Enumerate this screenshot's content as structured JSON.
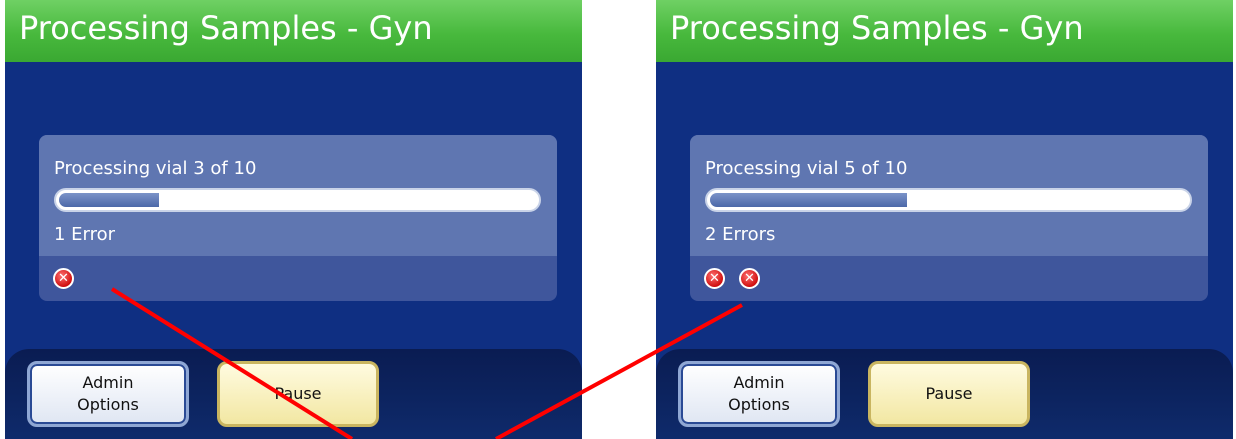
{
  "screens": [
    {
      "title": "Processing Samples - Gyn",
      "status": "Processing vial 3 of 10",
      "progress_fraction": 0.22,
      "errors_label": "1 Error",
      "error_count": 1,
      "buttons": {
        "admin": "Admin\nOptions",
        "pause": "Pause"
      }
    },
    {
      "title": "Processing Samples - Gyn",
      "status": "Processing vial 5 of 10",
      "progress_fraction": 0.42,
      "errors_label": "2 Errors",
      "error_count": 2,
      "buttons": {
        "admin": "Admin\nOptions",
        "pause": "Pause"
      }
    }
  ],
  "icons": {
    "error": "error-x-icon"
  },
  "colors": {
    "title_bar": "#48b93d",
    "screen_bg": "#0f2f82",
    "error": "#d01010",
    "annotation_line": "#ff0000"
  }
}
